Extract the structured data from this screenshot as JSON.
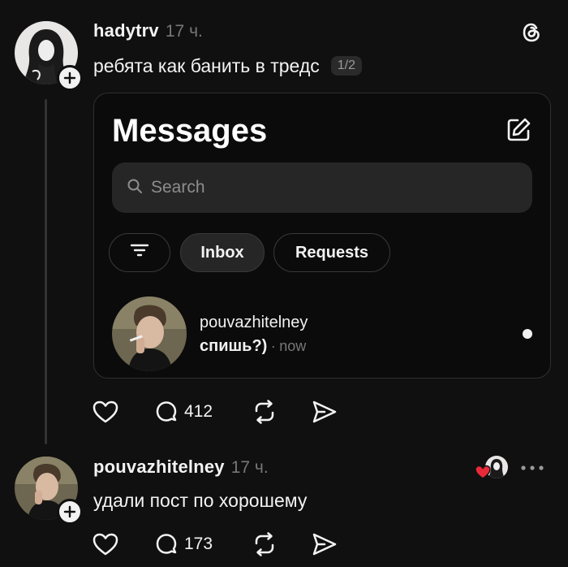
{
  "post1": {
    "username": "hadytrv",
    "time": "17 ч.",
    "text": "ребята как банить в тредс",
    "counter": "1/2",
    "actions": {
      "like_count": "",
      "comment_count": "412"
    }
  },
  "embedded_screenshot": {
    "title": "Messages",
    "search_placeholder": "Search",
    "filters": {
      "inbox_label": "Inbox",
      "requests_label": "Requests"
    },
    "conversation": {
      "name": "pouvazhitelney",
      "message": "спишь?)",
      "separator": "·",
      "time": "now"
    }
  },
  "post2": {
    "username": "pouvazhitelney",
    "time": "17 ч.",
    "text": "удали пост по хорошему",
    "actions": {
      "comment_count": "173"
    }
  },
  "icons": {
    "app_logo": "threads-logo-icon",
    "like": "heart-icon",
    "comment": "comment-icon",
    "repost": "repost-icon",
    "share": "send-icon",
    "more": "more-icon",
    "compose": "compose-icon",
    "search": "search-icon",
    "filter": "filter-icon",
    "follow": "plus-icon"
  },
  "colors": {
    "background": "#101010",
    "text": "#f3f3f3",
    "muted": "#777777",
    "liked_heart": "#e8293a"
  }
}
